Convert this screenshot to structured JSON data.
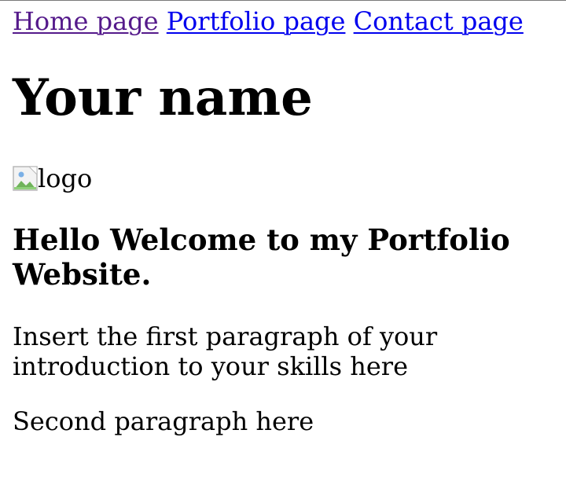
{
  "nav": {
    "links": [
      {
        "label": "Home page"
      },
      {
        "label": "Portfolio page"
      },
      {
        "label": "Contact page"
      }
    ]
  },
  "header": {
    "title": "Your name"
  },
  "logo": {
    "alt_text": "logo"
  },
  "main": {
    "welcome_heading": "Hello Welcome to my Portfolio Website.",
    "paragraph_1": "Insert the first paragraph of your introduction to your skills here",
    "paragraph_2": "Second paragraph here"
  },
  "colors": {
    "visited_link": "#551a8b",
    "link": "#0000ee"
  }
}
